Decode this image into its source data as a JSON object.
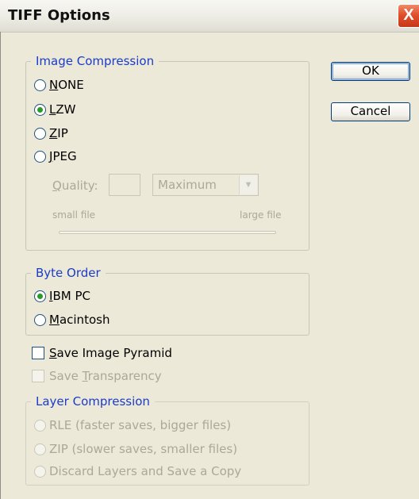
{
  "window": {
    "title": "TIFF Options",
    "close_glyph": "X"
  },
  "buttons": {
    "ok": "OK",
    "cancel": "Cancel"
  },
  "image_compression": {
    "legend": "Image Compression",
    "options": [
      {
        "acc": "N",
        "rest": "ONE",
        "selected": false
      },
      {
        "acc": "L",
        "rest": "ZW",
        "selected": true
      },
      {
        "acc": "Z",
        "rest": "IP",
        "selected": false
      },
      {
        "acc": "J",
        "rest": "PEG",
        "selected": false
      }
    ],
    "quality_label_acc": "Q",
    "quality_label_rest": "uality:",
    "quality_value": "",
    "quality_preset": "Maximum",
    "small_file": "small file",
    "large_file": "large file"
  },
  "byte_order": {
    "legend": "Byte Order",
    "options": [
      {
        "acc": "I",
        "rest": "BM PC",
        "selected": true
      },
      {
        "acc": "M",
        "rest": "acintosh",
        "selected": false
      }
    ]
  },
  "save_image_pyramid": {
    "acc": "S",
    "rest": "ave Image Pyramid",
    "checked": false
  },
  "save_transparency": {
    "pre": "Save ",
    "acc": "T",
    "rest": "ransparency",
    "checked": false
  },
  "layer_compression": {
    "legend": "Layer Compression",
    "options": [
      "RLE (faster saves, bigger files)",
      "ZIP (slower saves, smaller files)",
      "Discard Layers and Save a Copy"
    ]
  },
  "colors": {
    "legend_blue": "#1a3cc8",
    "radio_selected": "#2b9a2b",
    "disabled_text": "#aca899"
  }
}
